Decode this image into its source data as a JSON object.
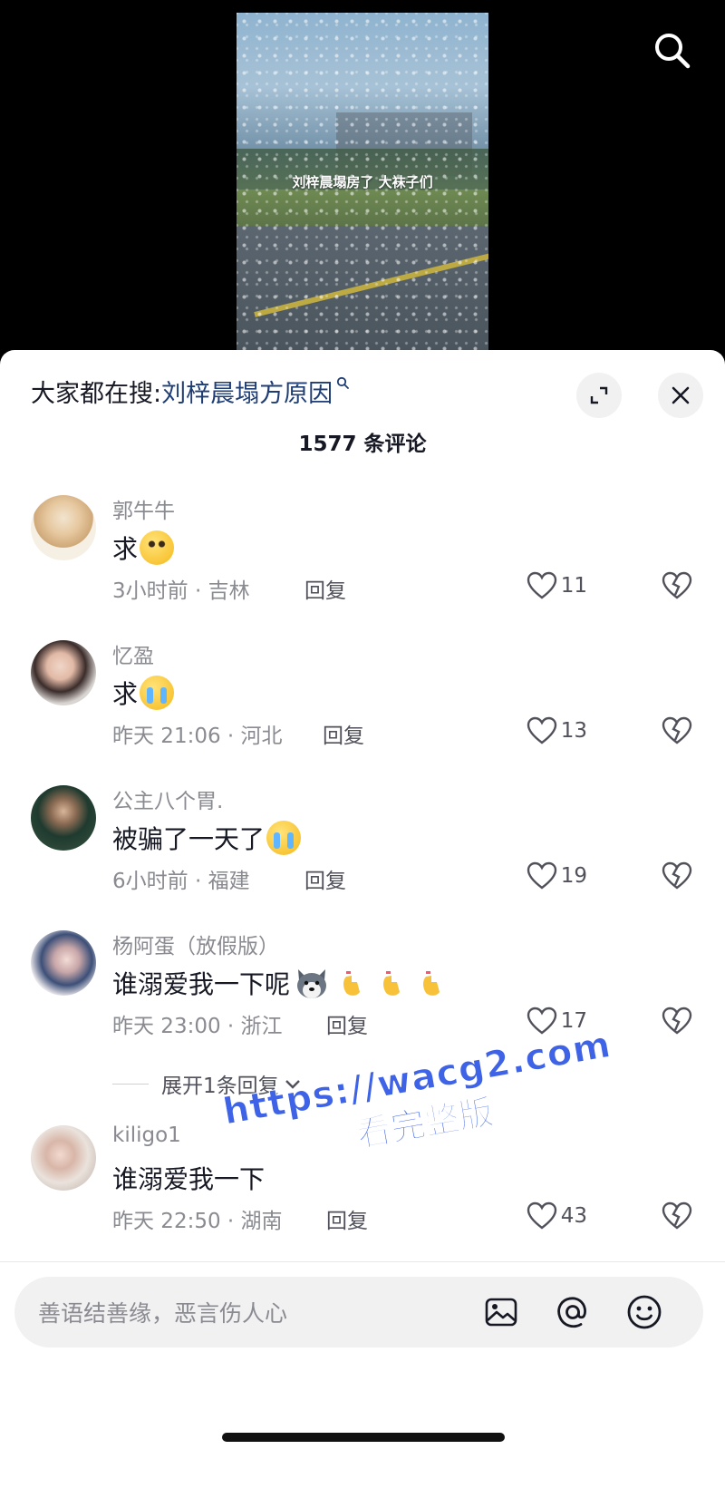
{
  "video": {
    "caption": "刘梓晨塌房了 大袜子们"
  },
  "sheet": {
    "trending_label": "大家都在搜:",
    "trending_term": "刘梓晨塌方原因",
    "comment_count": "1577 条评论"
  },
  "comments": [
    {
      "name": "郭牛牛",
      "text": "求",
      "time": "3小时前 · 吉林",
      "reply": "回复",
      "likes": "11"
    },
    {
      "name": "忆盈",
      "text": "求",
      "time": "昨天 21:06 · 河北",
      "reply": "回复",
      "likes": "13"
    },
    {
      "name": "公主八个胃.",
      "text": "被骗了一天了",
      "time": "6小时前 · 福建",
      "reply": "回复",
      "likes": "19"
    },
    {
      "name": "杨阿蛋（放假版）",
      "text": "谁溺爱我一下呢",
      "time": "昨天 23:00 · 浙江",
      "reply": "回复",
      "likes": "17"
    },
    {
      "name": "kiligo1",
      "text": "谁溺爱我一下",
      "time": "昨天 22:50 · 湖南",
      "reply": "回复",
      "likes": "43"
    }
  ],
  "expand_replies": "展开1条回复",
  "watermark": {
    "url": "https://wacg2.com",
    "sub": "看完整版"
  },
  "composer": {
    "placeholder": "善语结善缘，恶言伤人心"
  },
  "icons": {
    "top": "search-icon",
    "sheet": [
      "expand-icon",
      "close-icon"
    ],
    "comment_actions": [
      "heart-icon",
      "broken-heart-icon"
    ],
    "composer": [
      "image-icon",
      "at-icon",
      "emoji-icon"
    ]
  }
}
